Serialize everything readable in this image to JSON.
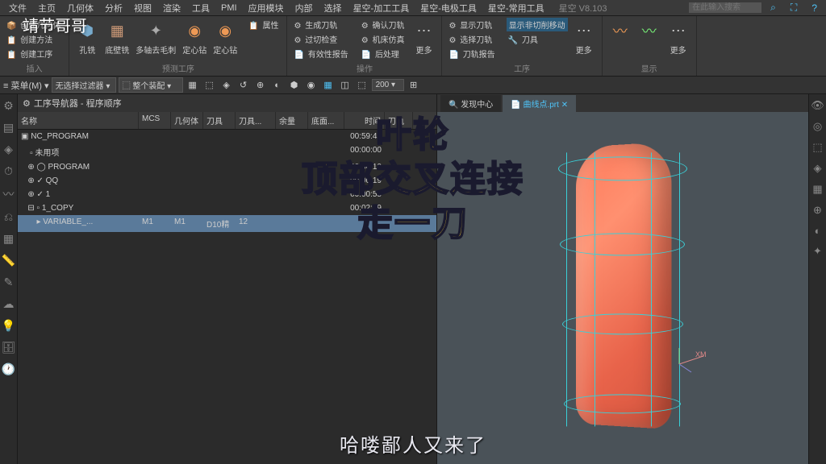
{
  "menu": {
    "items": [
      "文件",
      "主页",
      "几何体",
      "分析",
      "视图",
      "渲染",
      "工具",
      "PMI",
      "应用模块",
      "内部",
      "选择",
      "星空-加工工具",
      "星空-电极工具",
      "星空-常用工具"
    ],
    "version": "星空 V8.103",
    "search_ph": "在此输入搜索"
  },
  "ribbon": {
    "g1": {
      "btns": [
        "创建几何体",
        "创建方法",
        "创建工序"
      ],
      "label": "插入"
    },
    "g2": {
      "btns": [
        "孔铣",
        "底壁铣",
        "多轴去毛刺",
        "定心钻",
        "定心钻"
      ],
      "label": "预测工序",
      "attr": "属性"
    },
    "g3": {
      "items": [
        "生成刀轨",
        "过切检查",
        "有效性报告",
        "确认刀轨",
        "机床仿真",
        "后处理"
      ],
      "label": "操作",
      "more": "更多"
    },
    "g4": {
      "items": [
        "显示刀轨",
        "选择刀轨",
        "刀轨报告"
      ],
      "badge": "显示非切削移动",
      "tool": "刀具",
      "label": "工序",
      "more": "更多"
    },
    "g5": {
      "label": "显示",
      "more": "更多"
    }
  },
  "toolbar": {
    "menu": "菜单(M)",
    "filter": "无选择过滤器",
    "asm": "整个装配",
    "zoom": "200"
  },
  "nav": {
    "title": "工序导航器 - 程序顺序",
    "cols": [
      "名称",
      "MCS",
      "几何体",
      "刀具",
      "刀具...",
      "余量",
      "底面...",
      "时间",
      "刀轨"
    ],
    "rows": [
      {
        "name": "NC_PROGRAM",
        "time": "00:59:42",
        "indent": 0,
        "ic": "▣"
      },
      {
        "name": "未用项",
        "time": "00:00:00",
        "indent": 1,
        "ic": "▫"
      },
      {
        "name": "PROGRAM",
        "time": "00:56:10",
        "indent": 1,
        "ic": "◯",
        "pre": "⊕"
      },
      {
        "name": "QQ",
        "time": "00:00:19",
        "indent": 1,
        "ic": "✓",
        "pre": "⊕"
      },
      {
        "name": "1",
        "time": "00:00:55",
        "indent": 1,
        "ic": "✓",
        "pre": "⊕"
      },
      {
        "name": "1_COPY",
        "time": "00:02:19",
        "indent": 1,
        "ic": "▫",
        "pre": "⊟"
      },
      {
        "name": "VARIABLE_...",
        "mcs": "M1",
        "geo": "M1",
        "tool": "D10精",
        "th": "12",
        "time": "",
        "indent": 2,
        "ic": "▸",
        "sel": true
      }
    ]
  },
  "tabs": {
    "t1": "发现中心",
    "t2": "曲线点.prt"
  },
  "axis": {
    "xm": "XM"
  },
  "overlay": {
    "l1": "叶轮",
    "l2": "顶部交叉连接",
    "l3": "走一刀"
  },
  "subtitle": "哈喽鄙人又来了",
  "watermark": "靖节哥哥"
}
